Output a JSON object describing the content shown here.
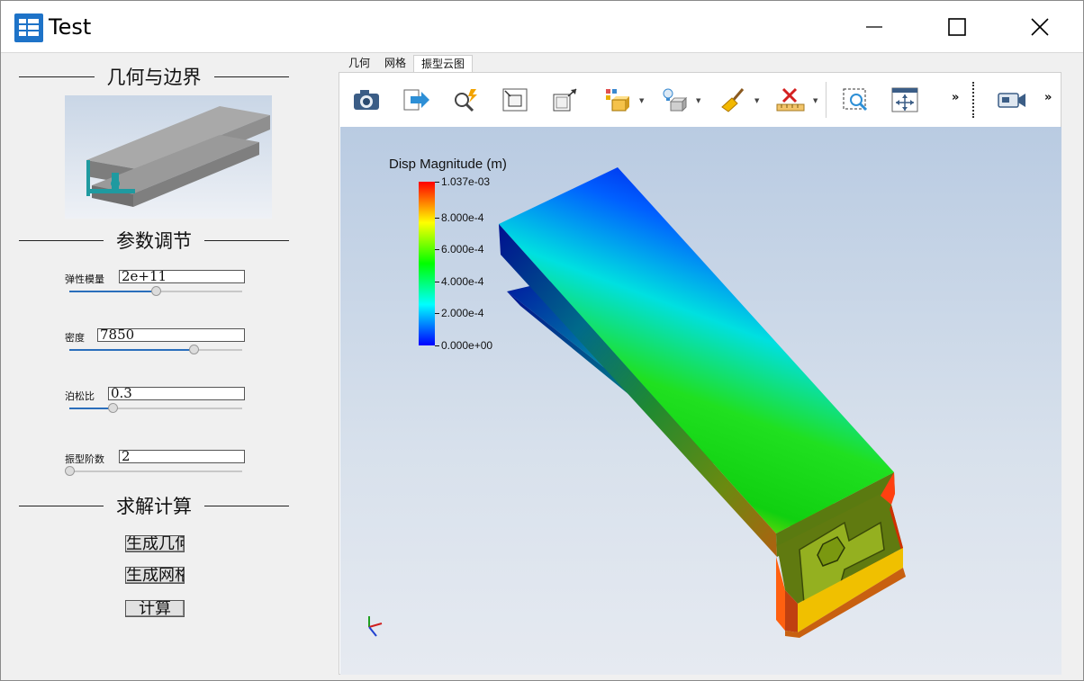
{
  "window": {
    "title": "Test"
  },
  "left": {
    "section_geometry": "几何与边界",
    "section_params": "参数调节",
    "section_solve": "求解计算",
    "params": [
      {
        "label": "弹性模量",
        "value": "2e+11",
        "slider_fraction": 0.5
      },
      {
        "label": "密度",
        "value": "7850",
        "slider_fraction": 0.72
      },
      {
        "label": "泊松比",
        "value": "0.3",
        "slider_fraction": 0.25
      },
      {
        "label": "振型阶数",
        "value": "2",
        "slider_fraction": 0.0
      }
    ],
    "buttons": [
      "生成几何",
      "生成网格",
      "计算"
    ]
  },
  "tabs": [
    {
      "label": "几何",
      "active": false
    },
    {
      "label": "网格",
      "active": false
    },
    {
      "label": "振型云图",
      "active": true
    }
  ],
  "toolbar": {
    "icons": [
      "camera-icon",
      "export-arrow-icon",
      "zoom-select-icon",
      "fit-view-icon",
      "resize-icon",
      "display-mode-icon",
      "lighting-icon",
      "clear-broom-icon",
      "measure-ruler-icon",
      "zoom-region-icon",
      "pan-move-icon",
      "record-video-icon"
    ],
    "more_glyph": "»"
  },
  "legend": {
    "title": "Disp Magnitude (m)",
    "labels": [
      "1.037e-03",
      "8.000e-4",
      "6.000e-4",
      "4.000e-4",
      "2.000e-4",
      "0.000e+00"
    ],
    "colors": [
      "#ff0000",
      "#ffff00",
      "#00ff00",
      "#00ffff",
      "#0000ff"
    ]
  }
}
